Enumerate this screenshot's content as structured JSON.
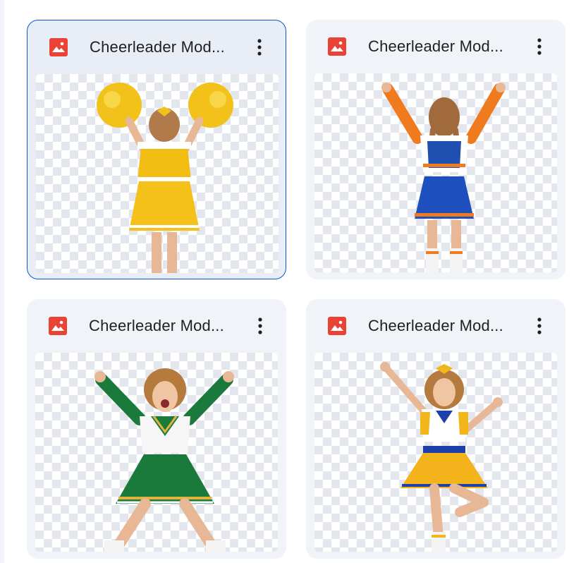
{
  "files": [
    {
      "name": "Cheerleader Mod...",
      "icon": "image-file-icon",
      "uniform": "yellow",
      "selected": true
    },
    {
      "name": "Cheerleader Mod...",
      "icon": "image-file-icon",
      "uniform": "blue-orange",
      "selected": false
    },
    {
      "name": "Cheerleader Mod...",
      "icon": "image-file-icon",
      "uniform": "green",
      "selected": false
    },
    {
      "name": "Cheerleader Mod...",
      "icon": "image-file-icon",
      "uniform": "yellow-blue",
      "selected": false
    }
  ],
  "colors": {
    "file_icon": "#ea4335",
    "selected_border": "#0b57d0",
    "card_bg": "#f0f4f9"
  }
}
